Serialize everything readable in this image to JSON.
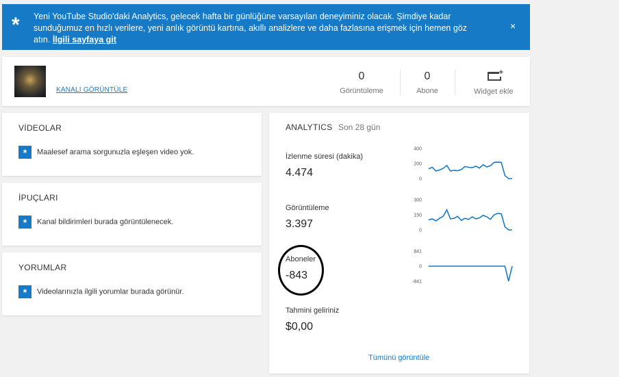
{
  "banner": {
    "icon": "asterisk-icon",
    "message": "Yeni YouTube Studio'daki Analytics, gelecek hafta bir günlüğüne varsayılan deneyiminiz olacak. Şimdiye kadar sunduğumuz en hızlı verilere, yeni anlık görüntü kartına, akıllı analizlere ve daha fazlasına erişmek için hemen göz atın.",
    "link": "İlgili sayfaya git",
    "close": "×",
    "color": "#167ac6"
  },
  "channel": {
    "link_label": "KANALI GÖRÜNTÜLE",
    "stats": [
      {
        "value": "0",
        "label": "Görüntüleme"
      },
      {
        "value": "0",
        "label": "Abone"
      }
    ],
    "widget_label": "Widget ekle"
  },
  "cards": [
    {
      "title": "VİDEOLAR",
      "tip": "Maalesef arama sorgunuzla eşleşen video yok."
    },
    {
      "title": "İPUÇLARI",
      "tip": "Kanal bildirimleri burada görüntülenecek."
    },
    {
      "title": "YORUMLAR",
      "tip": "Videolarınızla ilgili yorumlar burada görünür."
    }
  ],
  "analytics": {
    "title": "ANALYTICS",
    "period": "Son 28 gün",
    "metrics": [
      {
        "label": "İzlenme süresi (dakika)",
        "value": "4.474"
      },
      {
        "label": "Görüntüleme",
        "value": "3.397"
      },
      {
        "label": "Aboneler",
        "value": "-843"
      },
      {
        "label": "Tahmini geliriniz",
        "value": "$0,00"
      }
    ],
    "see_all": "Tümünü görüntüle",
    "line_color": "#167ac6"
  },
  "chart_data": [
    {
      "type": "line",
      "ylim": [
        0,
        400
      ],
      "yticks": [
        "400",
        "200",
        "0"
      ],
      "values": [
        130,
        150,
        100,
        115,
        135,
        175,
        100,
        110,
        105,
        120,
        160,
        150,
        145,
        165,
        140,
        185,
        155,
        170,
        215,
        220,
        215,
        40,
        0,
        0
      ]
    },
    {
      "type": "line",
      "ylim": [
        0,
        300
      ],
      "yticks": [
        "300",
        "150",
        "0"
      ],
      "values": [
        100,
        110,
        90,
        115,
        135,
        200,
        110,
        115,
        135,
        95,
        115,
        105,
        130,
        110,
        120,
        145,
        130,
        105,
        150,
        165,
        160,
        30,
        0,
        0
      ]
    },
    {
      "type": "line",
      "ylim": [
        -841,
        841
      ],
      "yticks": [
        "841",
        "0",
        "-841"
      ],
      "values": [
        0,
        0,
        0,
        0,
        0,
        0,
        0,
        0,
        0,
        0,
        0,
        0,
        0,
        0,
        0,
        0,
        0,
        0,
        0,
        0,
        0,
        0,
        -841,
        0
      ]
    }
  ]
}
